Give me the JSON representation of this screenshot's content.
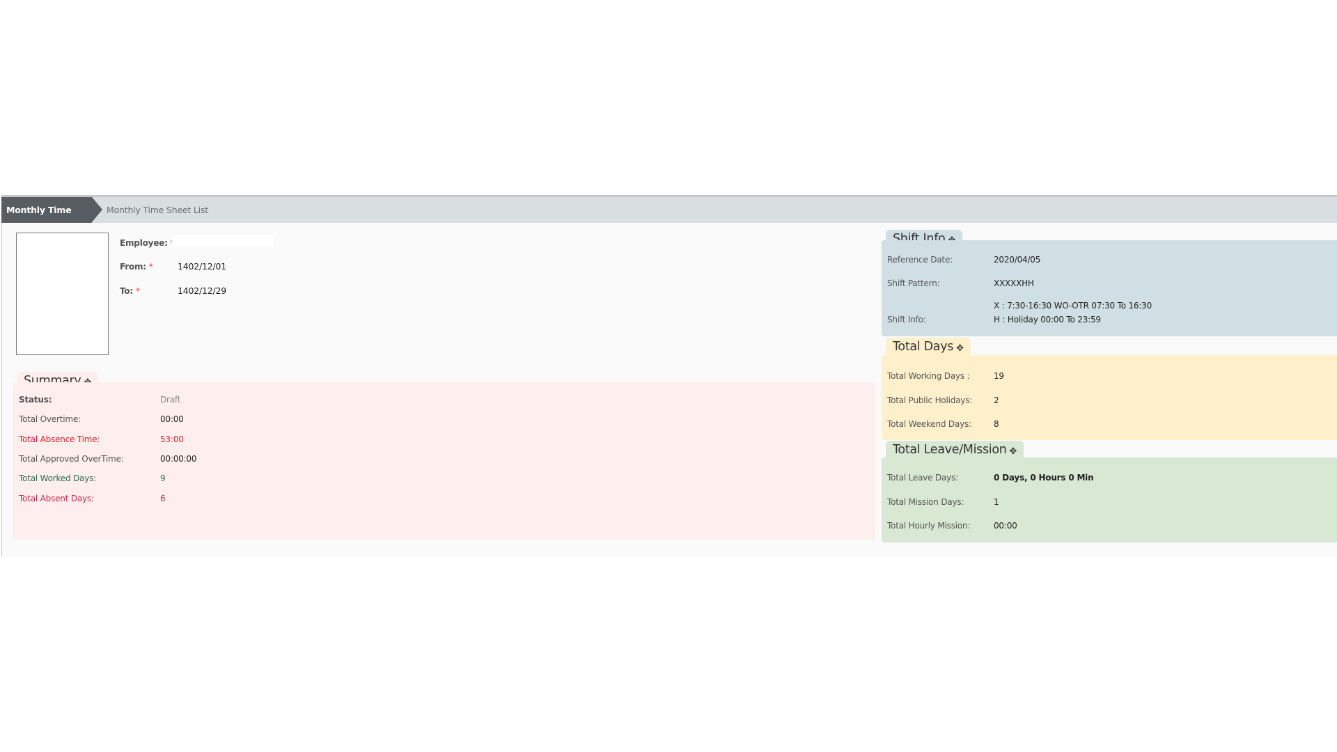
{
  "breadcrumb": {
    "active": "Monthly Time Sheet",
    "link": "Monthly Time Sheet List"
  },
  "header_form": {
    "employee_label": "Employee:",
    "employee_value": "",
    "from_label": "From:",
    "from_value": "1402/12/01",
    "to_label": "To:",
    "to_value": "1402/12/29",
    "required_marker": "*"
  },
  "summary": {
    "title": "Summary",
    "move_icon": "✥",
    "rows": [
      {
        "label": "Status:",
        "value": "Draft",
        "label_color": "#555555",
        "value_color": "#888888"
      },
      {
        "label": "Total Overtime:",
        "value": "00:00",
        "label_color": "#555555",
        "value_color": "#222222"
      },
      {
        "label": "Total Absence Time:",
        "value": "53:00",
        "label_color": "#e0202a",
        "value_color": "#e0202a"
      },
      {
        "label": "Total Approved OverTime:",
        "value": "00:00:00",
        "label_color": "#555555",
        "value_color": "#222222"
      },
      {
        "label": "Total Worked Days:",
        "value": "9",
        "label_color": "#2e6b4f",
        "value_color": "#2e6b4f"
      },
      {
        "label": "Total Absent Days:",
        "value": "6",
        "label_color": "#c62a4a",
        "value_color": "#c62a4a"
      }
    ]
  },
  "shift_info": {
    "title": "Shift Info",
    "move_icon": "✥",
    "reference_date_label": "Reference Date:",
    "reference_date_value": "2020/04/05",
    "shift_pattern_label": "Shift Pattern:",
    "shift_pattern_value": "XXXXXHH",
    "shift_info_label": "Shift Info:",
    "shift_info_lines": [
      "X : 7:30-16:30 WO-OTR 07:30 To 16:30",
      "H : Holiday 00:00 To 23:59"
    ]
  },
  "total_days": {
    "title": "Total Days",
    "move_icon": "✥",
    "rows": [
      {
        "label": "Total Working Days :",
        "value": "19"
      },
      {
        "label": "Total Public Holidays:",
        "value": "2"
      },
      {
        "label": "Total Weekend Days:",
        "value": "8"
      }
    ]
  },
  "leave_mission": {
    "title": "Total Leave/Mission",
    "move_icon": "✥",
    "rows": [
      {
        "label": "Total Leave Days:",
        "value": "0 Days, 0 Hours 0 Min",
        "bold": true
      },
      {
        "label": "Total Mission Days:",
        "value": "1",
        "bold": false
      },
      {
        "label": "Total Hourly Mission:",
        "value": "00:00",
        "bold": false
      }
    ]
  },
  "colors": {
    "breadcrumb_active_bg": "#575d61",
    "breadcrumb_bg": "#d9dee1",
    "summary_bg": "#ffeeee",
    "shift_bg": "#d0dfe3",
    "days_bg": "#fff0cc",
    "leave_bg": "#d8e8d2",
    "required": "#e53935"
  }
}
